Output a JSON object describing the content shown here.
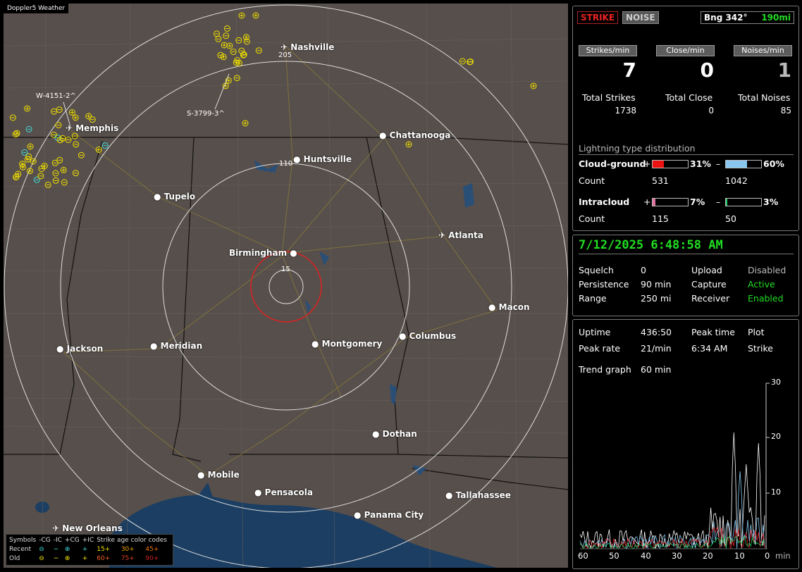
{
  "app_title": "Doppler5 Weather",
  "map": {
    "cities": [
      {
        "name": "Nashville",
        "icon": "airport-icon"
      },
      {
        "name": "Memphis",
        "icon": "airport-icon"
      },
      {
        "name": "Chattanooga",
        "icon": "dot-icon"
      },
      {
        "name": "Huntsville",
        "icon": "dot-icon"
      },
      {
        "name": "Tupelo",
        "icon": "dot-icon"
      },
      {
        "name": "Atlanta",
        "icon": "airport-icon"
      },
      {
        "name": "Birmingham",
        "icon": "dot-icon"
      },
      {
        "name": "Macon",
        "icon": "dot-icon"
      },
      {
        "name": "Jackson",
        "icon": "dot-icon"
      },
      {
        "name": "Meridian",
        "icon": "dot-icon"
      },
      {
        "name": "Montgomery",
        "icon": "dot-icon"
      },
      {
        "name": "Columbus",
        "icon": "dot-icon"
      },
      {
        "name": "Dothan",
        "icon": "dot-icon"
      },
      {
        "name": "Mobile",
        "icon": "dot-icon"
      },
      {
        "name": "Pensacola",
        "icon": "dot-icon"
      },
      {
        "name": "Tallahassee",
        "icon": "dot-icon"
      },
      {
        "name": "Panama City",
        "icon": "dot-icon"
      },
      {
        "name": "New Orleans",
        "icon": "airport-icon"
      }
    ],
    "range_labels": [
      "205",
      "110",
      "15"
    ],
    "storm_labels": [
      "W-4151-2^",
      "S-3799-3^"
    ],
    "legend": {
      "symbols_label": "Symbols",
      "cols": [
        "-CG",
        "-IC",
        "+CG",
        "+IC"
      ],
      "age_label": "Strike age color codes",
      "recent_label": "Recent",
      "old_label": "Old",
      "recent_ages": [
        "15+",
        "30+",
        "45+"
      ],
      "old_ages": [
        "60+",
        "75+",
        "90+"
      ]
    }
  },
  "top_panel": {
    "strike_btn": "STRIKE",
    "noise_btn": "NOISE",
    "bearing_label": "Bng 342°",
    "bearing_dist": "190mi",
    "rates": [
      {
        "label": "Strikes/min",
        "value": "7"
      },
      {
        "label": "Close/min",
        "value": "0"
      },
      {
        "label": "Noises/min",
        "value": "1"
      }
    ],
    "totals": [
      {
        "label": "Total Strikes",
        "value": "1738"
      },
      {
        "label": "Total Close",
        "value": "0"
      },
      {
        "label": "Total Noises",
        "value": "85"
      }
    ],
    "dist_title": "Lightning type distribution",
    "cg_label": "Cloud-ground",
    "cg_pos_pct": "31%",
    "cg_neg_pct": "60%",
    "cg_pos_frac": 0.31,
    "cg_neg_frac": 0.6,
    "count_label": "Count",
    "cg_pos_count": "531",
    "cg_neg_count": "1042",
    "ic_label": "Intracloud",
    "ic_pos_pct": "7%",
    "ic_neg_pct": "3%",
    "ic_pos_frac": 0.07,
    "ic_neg_frac": 0.03,
    "ic_pos_count": "115",
    "ic_neg_count": "50",
    "plus": "+",
    "minus": "–"
  },
  "status_panel": {
    "datetime": "7/12/2025 6:48:58 AM",
    "squelch_label": "Squelch",
    "squelch": "0",
    "persistence_label": "Persistence",
    "persistence": "90 min",
    "range_label": "Range",
    "range": "250 mi",
    "upload_label": "Upload",
    "upload": "Disabled",
    "capture_label": "Capture",
    "capture": "Active",
    "receiver_label": "Receiver",
    "receiver": "Enabled"
  },
  "trend_panel": {
    "uptime_label": "Uptime",
    "uptime": "436:50",
    "peak_time_label": "Peak time",
    "plot_label": "Plot",
    "peak_rate_label": "Peak rate",
    "peak_rate": "21/min",
    "peak_time": "6:34 AM",
    "plot": "Strike",
    "trend_label": "Trend graph",
    "trend": "60 min",
    "y_ticks": [
      "30",
      "20",
      "10"
    ],
    "x_ticks": [
      "60",
      "50",
      "40",
      "30",
      "20",
      "10",
      "0"
    ],
    "x_unit": "min"
  },
  "colors": {
    "map_bg": "#574f4b",
    "water": "#1b3e62",
    "yellow": "#f0e000",
    "cyan": "#40d8d8",
    "green": "#22dd22",
    "red": "#cc1111"
  }
}
